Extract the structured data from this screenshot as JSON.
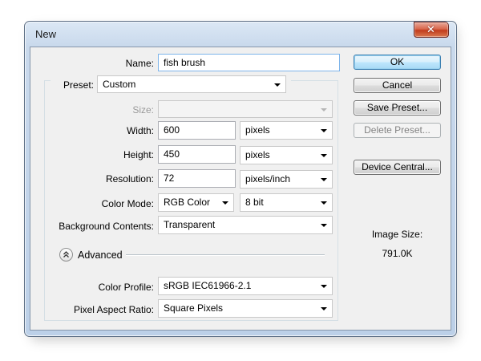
{
  "window": {
    "title": "New",
    "close_glyph": "✕"
  },
  "form": {
    "name_label": "Name:",
    "name_value": "fish brush",
    "preset_label": "Preset:",
    "preset_value": "Custom",
    "size_label": "Size:",
    "size_value": "",
    "width_label": "Width:",
    "width_value": "600",
    "width_unit": "pixels",
    "height_label": "Height:",
    "height_value": "450",
    "height_unit": "pixels",
    "resolution_label": "Resolution:",
    "resolution_value": "72",
    "resolution_unit": "pixels/inch",
    "color_mode_label": "Color Mode:",
    "color_mode_value": "RGB Color",
    "bit_depth_value": "8 bit",
    "background_label": "Background Contents:",
    "background_value": "Transparent",
    "advanced_label": "Advanced",
    "color_profile_label": "Color Profile:",
    "color_profile_value": "sRGB IEC61966-2.1",
    "pixel_aspect_label": "Pixel Aspect Ratio:",
    "pixel_aspect_value": "Square Pixels"
  },
  "buttons": {
    "ok": "OK",
    "cancel": "Cancel",
    "save_preset": "Save Preset...",
    "delete_preset": "Delete Preset...",
    "device_central": "Device Central..."
  },
  "image_size": {
    "label": "Image Size:",
    "value": "791.0K"
  },
  "icons": {
    "advanced_toggle": "chevron-up-double-icon",
    "dropdown": "chevron-down-icon",
    "close": "close-icon"
  },
  "colors": {
    "close_button": "#c23d1c",
    "default_button_border": "#3c7fb1"
  }
}
